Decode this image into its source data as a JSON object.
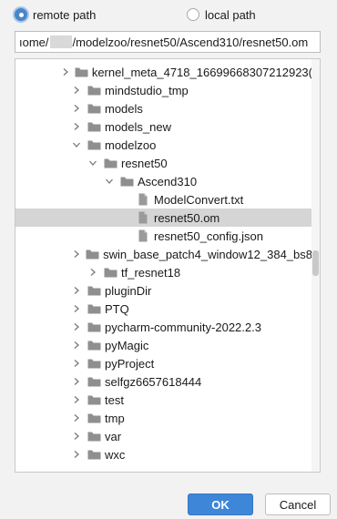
{
  "path_type": {
    "remote_label": "remote path",
    "local_label": "local path",
    "selected": "remote"
  },
  "path_field": {
    "prefix": "ıome/",
    "suffix": "/modelzoo/resnet50/Ascend310/resnet50.om"
  },
  "tree": {
    "rows": [
      {
        "label": "kernel_meta_4718_16699668307212923(",
        "kind": "folder",
        "depth": 0,
        "expanded": false
      },
      {
        "label": "mindstudio_tmp",
        "kind": "folder",
        "depth": 0,
        "expanded": false
      },
      {
        "label": "models",
        "kind": "folder",
        "depth": 0,
        "expanded": false
      },
      {
        "label": "models_new",
        "kind": "folder",
        "depth": 0,
        "expanded": false
      },
      {
        "label": "modelzoo",
        "kind": "folder",
        "depth": 0,
        "expanded": true
      },
      {
        "label": "resnet50",
        "kind": "folder",
        "depth": 1,
        "expanded": true
      },
      {
        "label": "Ascend310",
        "kind": "folder",
        "depth": 2,
        "expanded": true
      },
      {
        "label": "ModelConvert.txt",
        "kind": "file",
        "depth": 3
      },
      {
        "label": "resnet50.om",
        "kind": "file",
        "depth": 3,
        "selected": true
      },
      {
        "label": "resnet50_config.json",
        "kind": "file",
        "depth": 3
      },
      {
        "label": "swin_base_patch4_window12_384_bs8",
        "kind": "folder",
        "depth": 1,
        "expanded": false
      },
      {
        "label": "tf_resnet18",
        "kind": "folder",
        "depth": 1,
        "expanded": false
      },
      {
        "label": "pluginDir",
        "kind": "folder",
        "depth": 0,
        "expanded": false
      },
      {
        "label": "PTQ",
        "kind": "folder",
        "depth": 0,
        "expanded": false
      },
      {
        "label": "pycharm-community-2022.2.3",
        "kind": "folder",
        "depth": 0,
        "expanded": false
      },
      {
        "label": "pyMagic",
        "kind": "folder",
        "depth": 0,
        "expanded": false
      },
      {
        "label": "pyProject",
        "kind": "folder",
        "depth": 0,
        "expanded": false
      },
      {
        "label": "selfgz6657618444",
        "kind": "folder",
        "depth": 0,
        "expanded": false
      },
      {
        "label": "test",
        "kind": "folder",
        "depth": 0,
        "expanded": false
      },
      {
        "label": "tmp",
        "kind": "folder",
        "depth": 0,
        "expanded": false
      },
      {
        "label": "var",
        "kind": "folder",
        "depth": 0,
        "expanded": false
      },
      {
        "label": "wxc",
        "kind": "folder",
        "depth": 0,
        "expanded": false
      }
    ]
  },
  "buttons": {
    "ok": "OK",
    "cancel": "Cancel"
  },
  "icons": {
    "folder": "folder-icon",
    "file": "file-icon",
    "collapsed": "chevron-right-icon",
    "expanded": "chevron-down-icon"
  },
  "colors": {
    "accent": "#3d86d8",
    "folder": "#8f8f8f",
    "selection": "#d5d5d5"
  }
}
